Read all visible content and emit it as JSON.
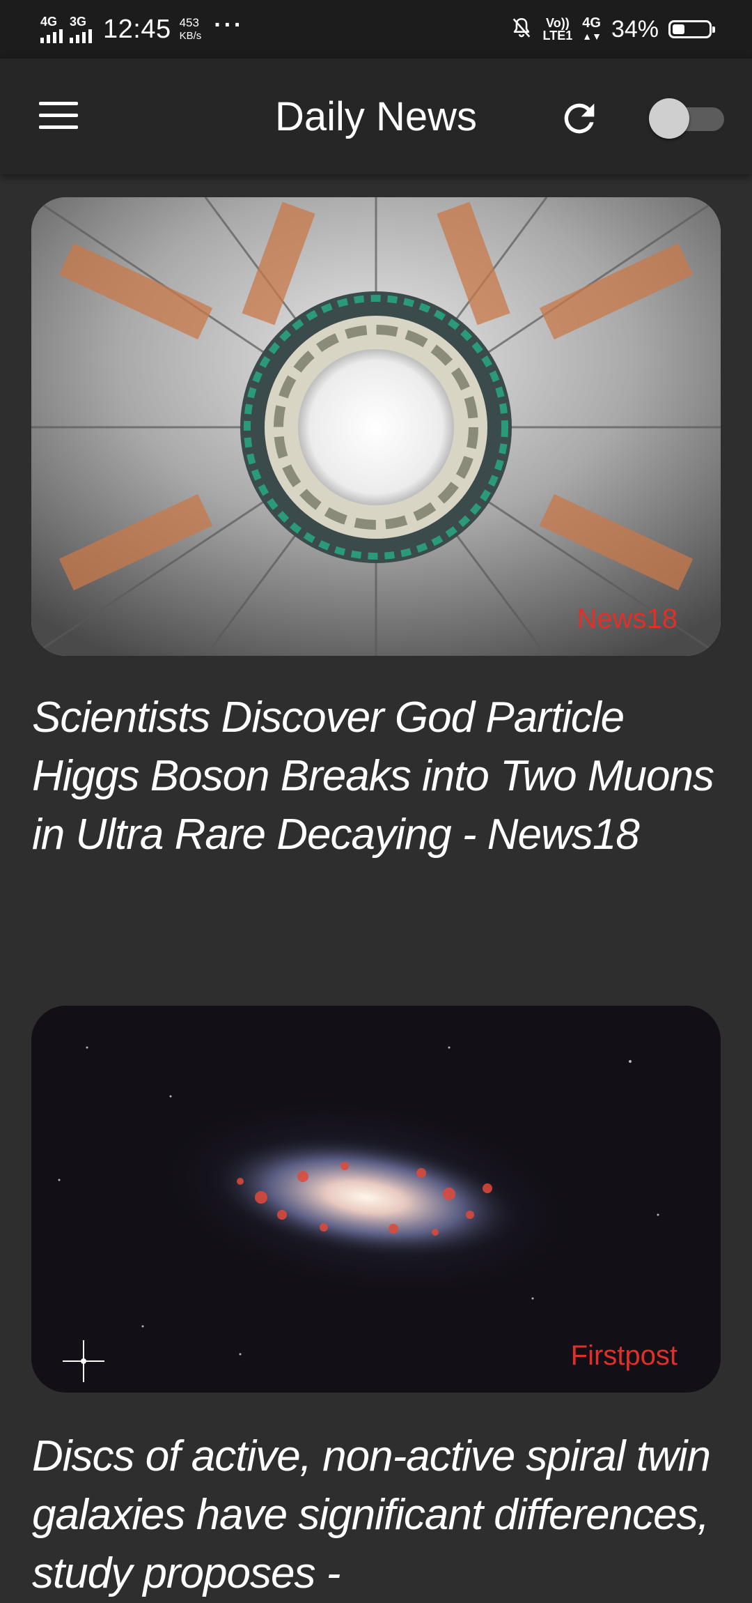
{
  "status_bar": {
    "net1": "4G",
    "net2": "3G",
    "time": "12:45",
    "speed_value": "453",
    "speed_unit": "KB/s",
    "more": "···",
    "volte_top": "Vo))",
    "volte_bottom": "LTE1",
    "net3": "4G",
    "battery_percent": "34%",
    "battery_level": 0.34,
    "icons": [
      "signal-icon",
      "signal-icon",
      "notification-off-icon",
      "battery-icon"
    ]
  },
  "app_bar": {
    "title": "Daily News",
    "menu_icon": "hamburger-menu-icon",
    "refresh_icon": "refresh-icon",
    "dark_mode_toggle": "off"
  },
  "articles": [
    {
      "source": "News18",
      "headline": "Scientists Discover God Particle Higgs Boson Breaks into Two Muons in Ultra Rare Decaying - News18",
      "image": "particle-detector-image"
    },
    {
      "source": "Firstpost",
      "headline": "Discs of active, non-active spiral twin galaxies have significant differences, study proposes -",
      "image": "spiral-galaxy-image"
    }
  ]
}
